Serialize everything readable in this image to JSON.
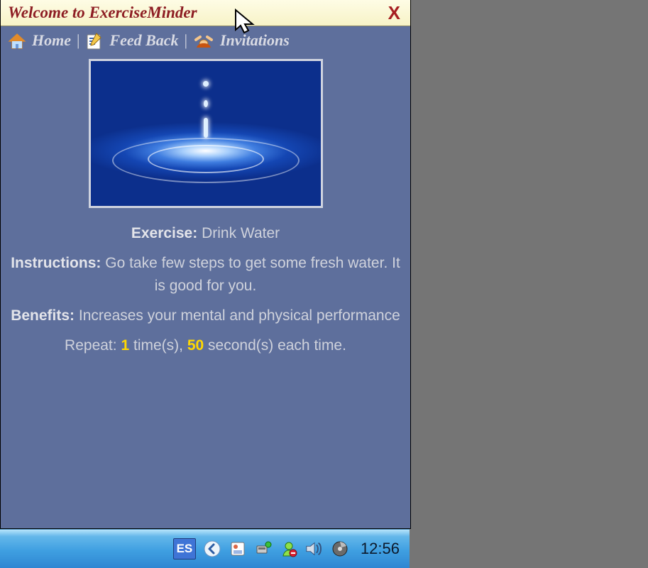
{
  "window": {
    "title": "Welcome to ExerciseMinder",
    "close": "X"
  },
  "nav": {
    "home": "Home",
    "feedback": "Feed Back",
    "invitations": "Invitations"
  },
  "exercise": {
    "label": "Exercise",
    "name": "Drink Water",
    "instructions_label": "Instructions",
    "instructions": "Go take few steps to get some fresh water. It is good for you.",
    "benefits_label": "Benefits",
    "benefits": "Increases your mental and physical performance",
    "repeat_prefix": "Repeat:",
    "repeat_times": "1",
    "repeat_times_unit": "time(s),",
    "repeat_seconds": "50",
    "repeat_seconds_unit": "second(s) each time."
  },
  "taskbar": {
    "language": "ES",
    "clock": "12:56"
  }
}
